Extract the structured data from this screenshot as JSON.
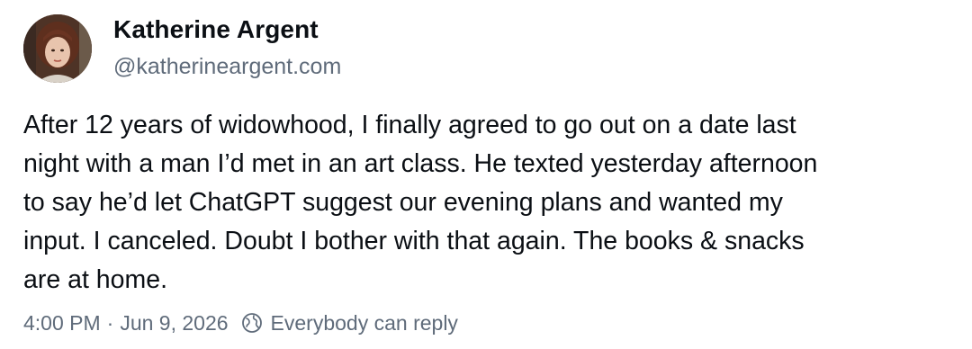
{
  "post": {
    "author": {
      "name": "Katherine Argent",
      "handle": "@katherineargent.com"
    },
    "text_lines": [
      "After 12 years of widowhood, I finally agreed to go out on a date last",
      "night with a man I’d met in an art class. He texted yesterday afternoon",
      "to say he’d let ChatGPT suggest our evening plans and wanted my",
      "input. I canceled. Doubt I bother with that again. The books & snacks",
      "are at home."
    ],
    "meta": {
      "time": "4:00 PM",
      "separator": "·",
      "date": "Jun 9, 2026",
      "reply_setting": "Everybody can reply",
      "reply_icon": "globe-icon"
    }
  },
  "colors": {
    "text": "#0b0f14",
    "muted": "#5f6b7a",
    "background": "#ffffff"
  }
}
